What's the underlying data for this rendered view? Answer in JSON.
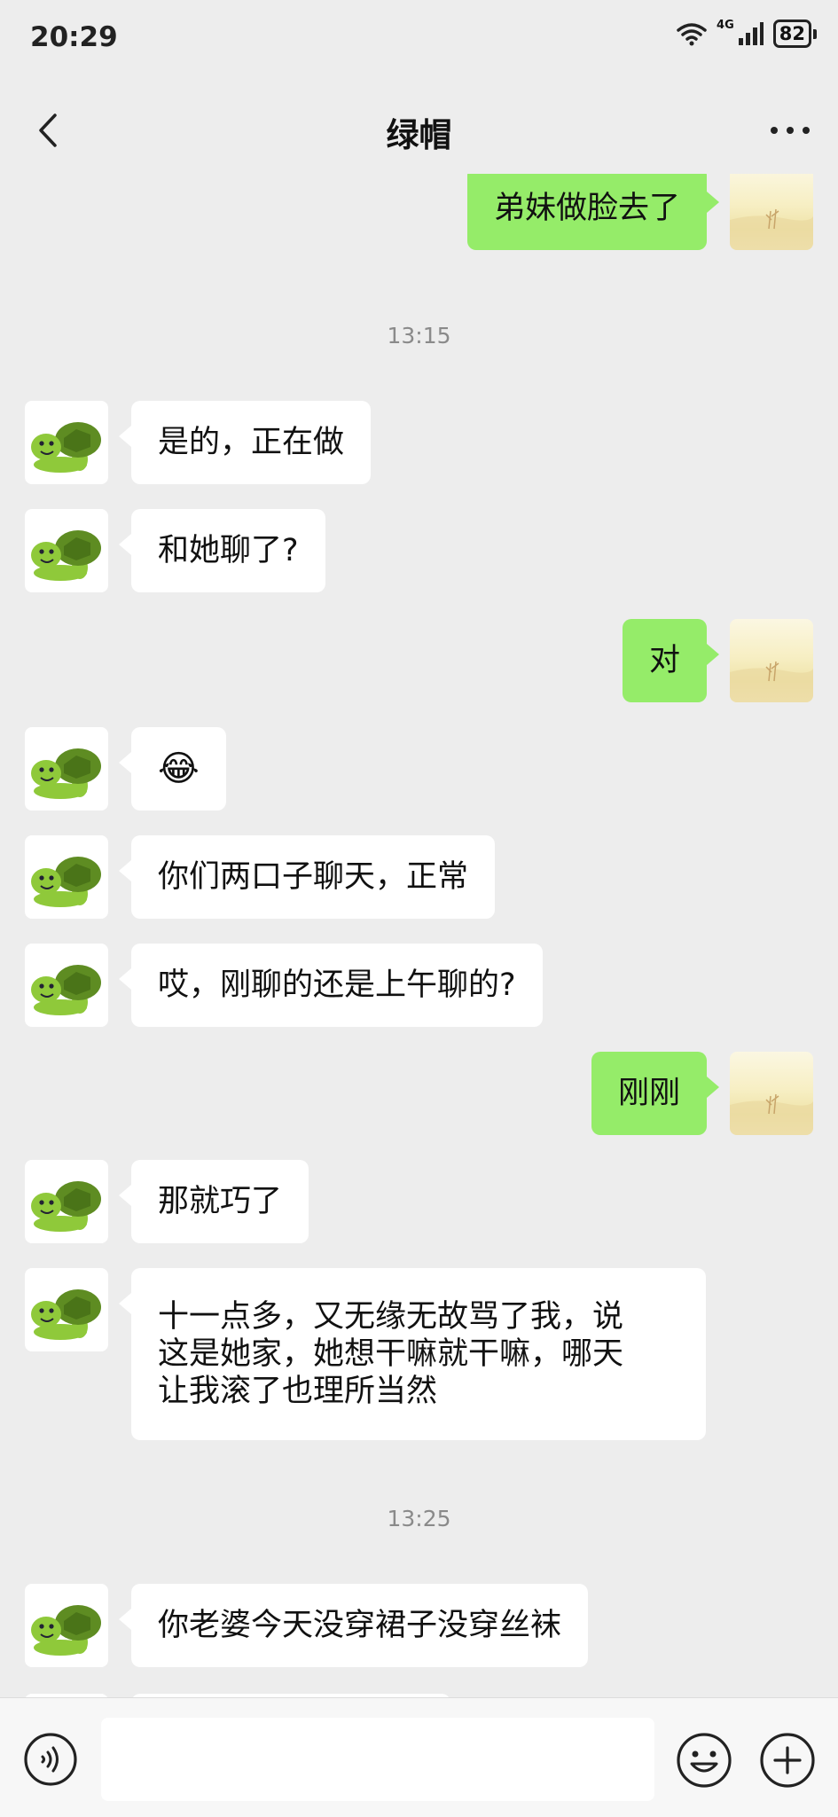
{
  "status_bar": {
    "time": "20:29",
    "network": "4G",
    "battery": "82"
  },
  "header": {
    "title": "绿帽"
  },
  "messages": [
    {
      "side": "right",
      "text": "弟妹做脸去了"
    },
    {
      "timestamp": "13:15"
    },
    {
      "side": "left",
      "text": "是的，正在做"
    },
    {
      "side": "left",
      "text": "和她聊了?"
    },
    {
      "side": "right",
      "text": "对"
    },
    {
      "side": "left",
      "emoji": "😂"
    },
    {
      "side": "left",
      "text": "你们两口子聊天，正常"
    },
    {
      "side": "left",
      "text": "哎，刚聊的还是上午聊的?"
    },
    {
      "side": "right",
      "text": "刚刚"
    },
    {
      "side": "left",
      "text": "那就巧了"
    },
    {
      "side": "left",
      "lines": [
        "十一点多，又无缘无故骂了我，说",
        "这是她家，她想干嘛就干嘛，哪天",
        "让我滚了也理所当然"
      ]
    },
    {
      "timestamp": "13:25"
    },
    {
      "side": "left",
      "text": "你老婆今天没穿裙子没穿丝袜"
    }
  ],
  "input": {
    "value": ""
  },
  "icons": {
    "back": "chevron-left-icon",
    "more": "more-dots-icon",
    "voice": "voice-icon",
    "emoji": "emoji-icon",
    "plus": "plus-icon",
    "contact_avatar": "turtle-avatar",
    "self_avatar": "landscape-avatar"
  },
  "colors": {
    "background": "#ededed",
    "sent_bubble": "#95ec69",
    "received_bubble": "#ffffff",
    "timestamp": "#8a8a8a"
  }
}
